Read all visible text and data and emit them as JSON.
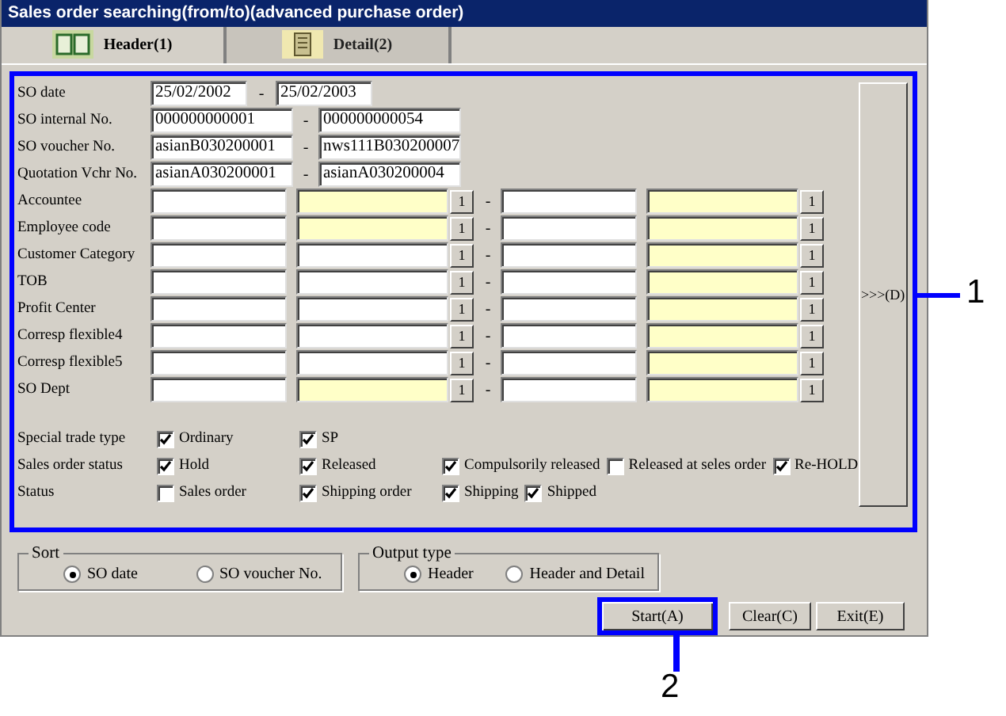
{
  "window": {
    "title": "Sales order searching(from/to)(advanced purchase order)"
  },
  "tabs": [
    {
      "label": "Header(1)",
      "selected": true
    },
    {
      "label": "Detail(2)",
      "selected": false
    }
  ],
  "ranges": [
    {
      "label": "SO date",
      "kind": "date",
      "from": "25/02/2002",
      "separator": "-",
      "to": "25/02/2003"
    },
    {
      "label": "SO internal No.",
      "kind": "text",
      "from": "000000000001",
      "separator": "-",
      "to": "000000000054"
    },
    {
      "label": "SO voucher No.",
      "kind": "text",
      "from": "asianB030200001",
      "separator": "-",
      "to": "nws111B030200007"
    },
    {
      "label": "Quotation Vchr No.",
      "kind": "text",
      "from": "asianA030200001",
      "separator": "-",
      "to": "asianA030200004"
    }
  ],
  "lookups": [
    {
      "label": "Accountee",
      "from_name_readonly": true,
      "from_button": "1",
      "separator": "-",
      "to_name_readonly": true,
      "to_button": "1"
    },
    {
      "label": "Employee code",
      "from_name_readonly": true,
      "from_button": "1",
      "separator": "-",
      "to_name_readonly": true,
      "to_button": "1"
    },
    {
      "label": "Customer Category",
      "from_name_readonly": false,
      "from_button": "1",
      "separator": "-",
      "to_name_readonly": true,
      "to_button": "1"
    },
    {
      "label": "TOB",
      "from_name_readonly": false,
      "from_button": "1",
      "separator": "-",
      "to_name_readonly": true,
      "to_button": "1"
    },
    {
      "label": "Profit Center",
      "from_name_readonly": false,
      "from_button": "1",
      "separator": "-",
      "to_name_readonly": true,
      "to_button": "1"
    },
    {
      "label": "Corresp flexible4",
      "from_name_readonly": false,
      "from_button": "1",
      "separator": "-",
      "to_name_readonly": true,
      "to_button": "1"
    },
    {
      "label": "Corresp flexible5",
      "from_name_readonly": false,
      "from_button": "1",
      "separator": "-",
      "to_name_readonly": true,
      "to_button": "1"
    },
    {
      "label": "SO Dept",
      "from_name_readonly": true,
      "from_button": "1",
      "separator": "-",
      "to_name_readonly": true,
      "to_button": "1"
    }
  ],
  "side_button": ">>>(D)",
  "check_groups": [
    {
      "label": "Special trade type",
      "options": [
        {
          "label": "Ordinary",
          "checked": true
        },
        {
          "label": "SP",
          "checked": true
        }
      ]
    },
    {
      "label": "Sales order status",
      "options": [
        {
          "label": "Hold",
          "checked": true
        },
        {
          "label": "Released",
          "checked": true
        },
        {
          "label": "Compulsorily released",
          "checked": true
        },
        {
          "label": "Released at seles order",
          "checked": false
        },
        {
          "label": "Re-HOLD",
          "checked": true
        }
      ]
    },
    {
      "label": "Status",
      "options": [
        {
          "label": "Sales order",
          "checked": false
        },
        {
          "label": "Shipping order",
          "checked": true
        },
        {
          "label": "Shipping",
          "checked": true
        },
        {
          "label": "Shipped",
          "checked": true
        }
      ]
    }
  ],
  "radio_groups": [
    {
      "title": "Sort",
      "options": [
        {
          "label": "SO date",
          "selected": true
        },
        {
          "label": "SO voucher No.",
          "selected": false
        }
      ]
    },
    {
      "title": "Output type",
      "options": [
        {
          "label": "Header",
          "selected": true
        },
        {
          "label": "Header and Detail",
          "selected": false
        }
      ]
    }
  ],
  "buttons": [
    {
      "label": "Start(A)",
      "highlighted": true
    },
    {
      "label": "Clear(C)",
      "highlighted": false
    },
    {
      "label": "Exit(E)",
      "highlighted": false
    }
  ],
  "callouts": [
    {
      "label": "1"
    },
    {
      "label": "2"
    }
  ]
}
